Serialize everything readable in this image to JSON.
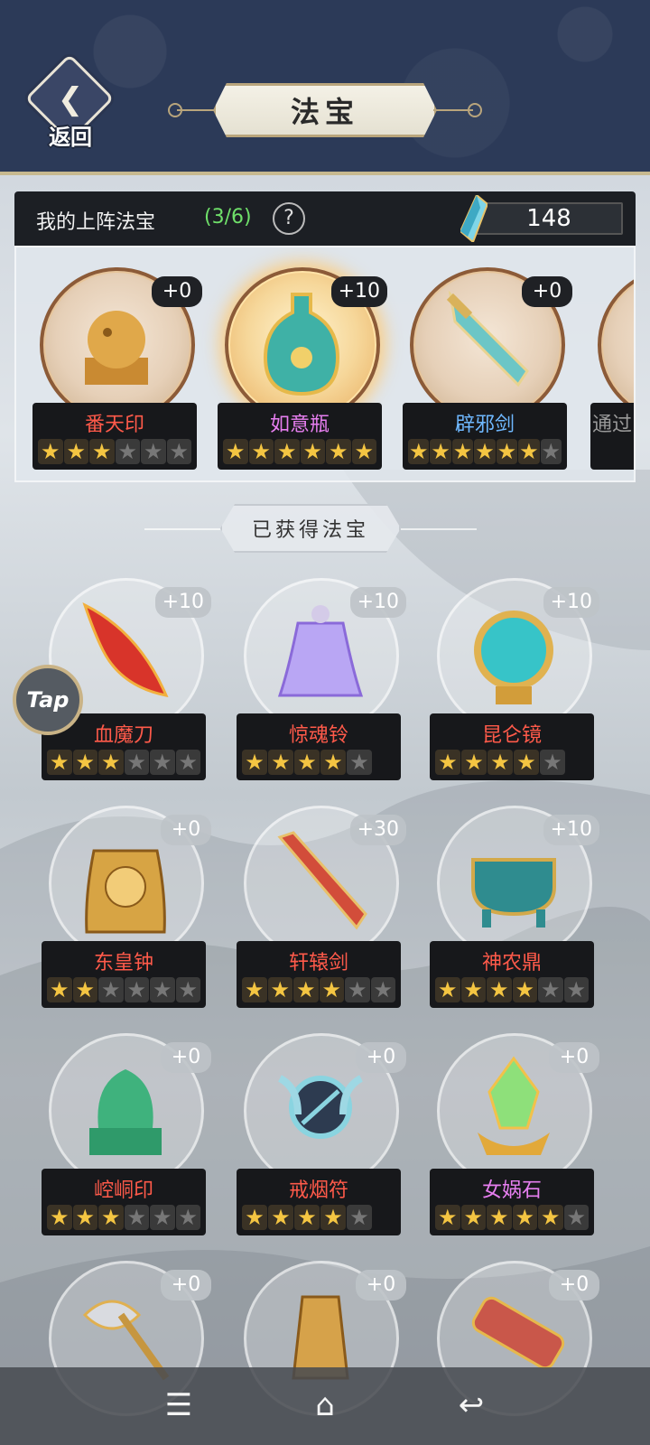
{
  "header": {
    "back_label": "返回",
    "title": "法宝"
  },
  "lineup": {
    "label": "我的上阵法宝",
    "count": "(3/6)",
    "help": "?",
    "currency": "148",
    "cards": [
      {
        "name": "番天印",
        "level": "+0",
        "stars": 3,
        "max": 6,
        "color": "#ff5a4a",
        "icon": "seal-icon",
        "glow": false
      },
      {
        "name": "如意瓶",
        "level": "+10",
        "stars": 6,
        "max": 6,
        "color": "#e77ff0",
        "icon": "vase-icon",
        "glow": true
      },
      {
        "name": "辟邪剑",
        "level": "+0",
        "stars": 6,
        "max": 7,
        "color": "#6fb8ff",
        "icon": "sword-icon",
        "glow": false
      }
    ],
    "partial_card_text": "通过"
  },
  "section": {
    "title": "已获得法宝"
  },
  "tap": "Tap",
  "obtained": [
    {
      "name": "血魔刀",
      "level": "+10",
      "stars": 3,
      "max": 6,
      "color": "#ff5a4a",
      "icon": "blade-icon"
    },
    {
      "name": "惊魂铃",
      "level": "+10",
      "stars": 4,
      "max": 5,
      "color": "#ff5a4a",
      "icon": "bell-icon"
    },
    {
      "name": "昆仑镜",
      "level": "+10",
      "stars": 4,
      "max": 5,
      "color": "#ff5a4a",
      "icon": "mirror-icon"
    },
    {
      "name": "东皇钟",
      "level": "+0",
      "stars": 2,
      "max": 6,
      "color": "#ff5a4a",
      "icon": "great-bell-icon"
    },
    {
      "name": "轩辕剑",
      "level": "+30",
      "stars": 4,
      "max": 6,
      "color": "#ff5a4a",
      "icon": "red-sword-icon"
    },
    {
      "name": "神农鼎",
      "level": "+10",
      "stars": 4,
      "max": 6,
      "color": "#ff5a4a",
      "icon": "cauldron-icon"
    },
    {
      "name": "崆峒印",
      "level": "+0",
      "stars": 3,
      "max": 6,
      "color": "#ff5a4a",
      "icon": "jade-seal-icon"
    },
    {
      "name": "戒烟符",
      "level": "+0",
      "stars": 4,
      "max": 5,
      "color": "#ff5a4a",
      "icon": "talisman-icon"
    },
    {
      "name": "女娲石",
      "level": "+0",
      "stars": 5,
      "max": 6,
      "color": "#e77ff0",
      "icon": "crystal-stone-icon"
    },
    {
      "name": "",
      "level": "+0",
      "stars": 0,
      "max": 0,
      "color": "#ff5a4a",
      "icon": "axe-icon"
    },
    {
      "name": "",
      "level": "+0",
      "stars": 0,
      "max": 0,
      "color": "#ff5a4a",
      "icon": "tower-icon"
    },
    {
      "name": "",
      "level": "+0",
      "stars": 0,
      "max": 0,
      "color": "#ff5a4a",
      "icon": "zither-icon"
    }
  ],
  "navbar": {
    "menu": "☰",
    "home": "⌂",
    "back": "↩"
  }
}
